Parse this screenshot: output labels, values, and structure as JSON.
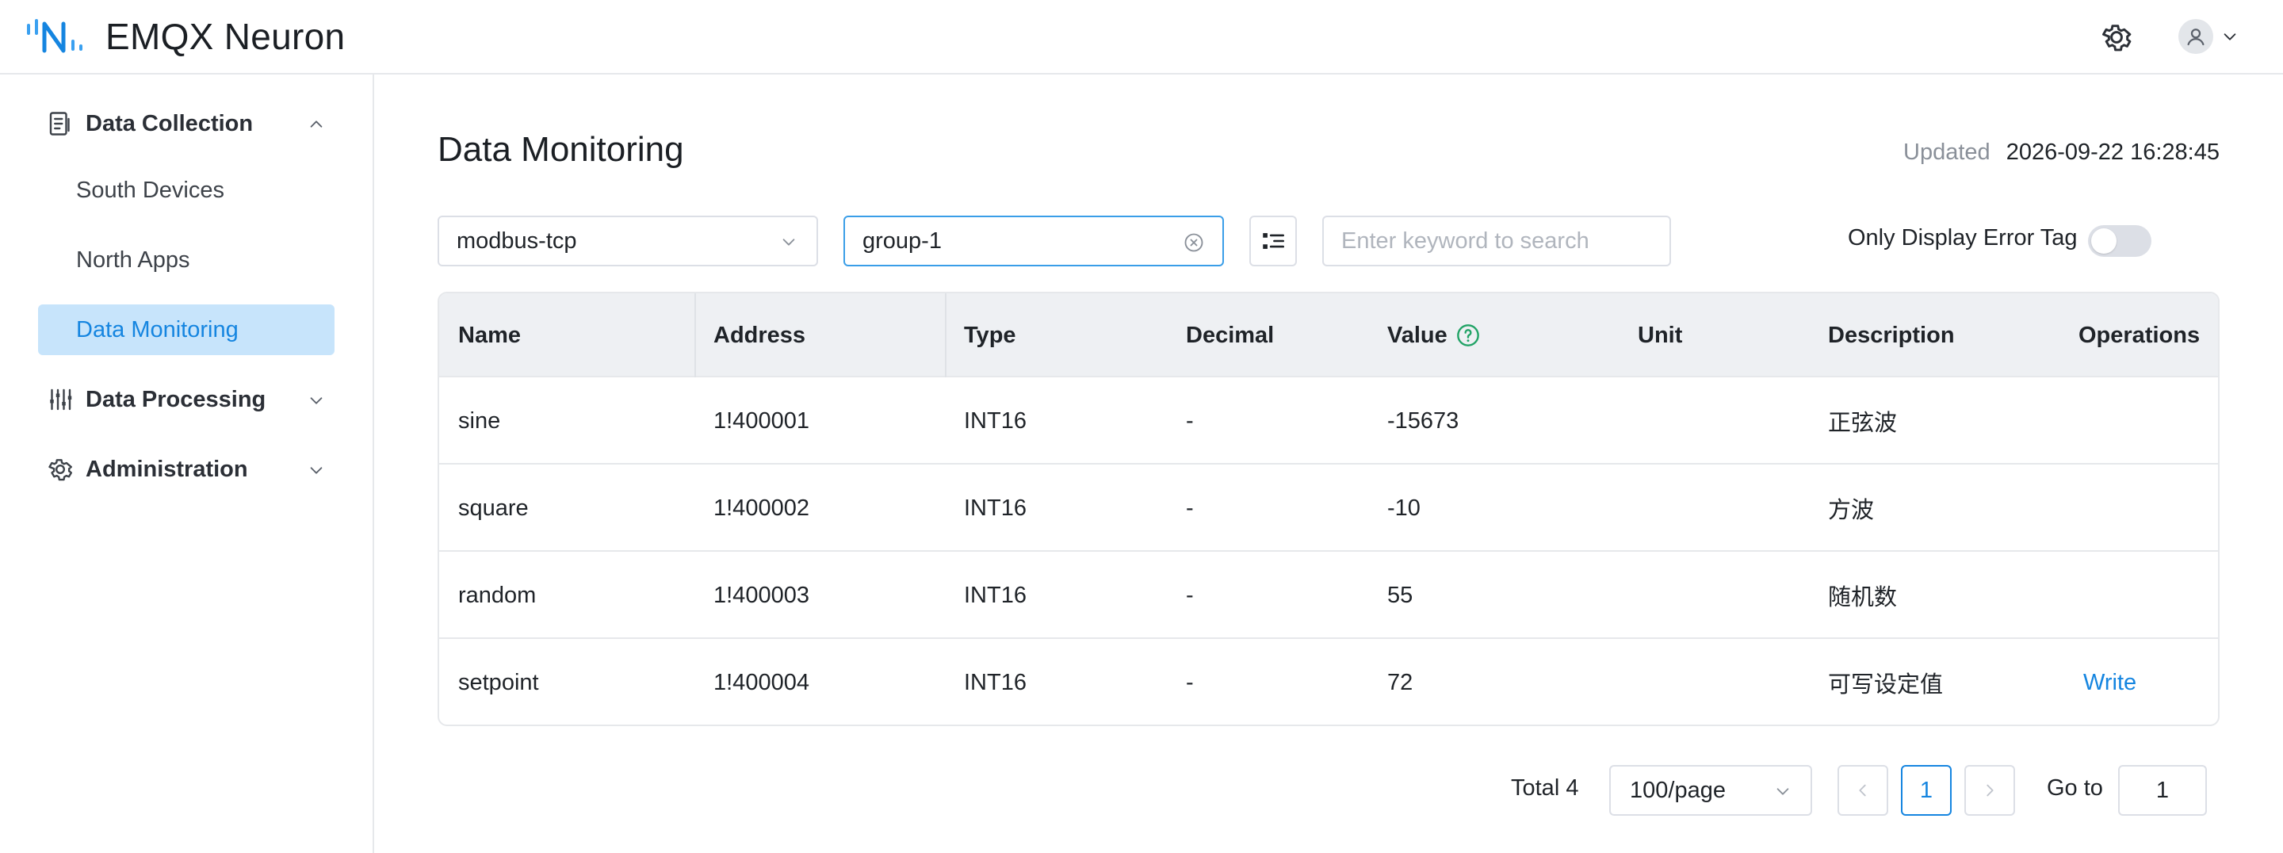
{
  "app": {
    "brand": "EMQX Neuron",
    "accent_color": "#1585e0"
  },
  "header": {
    "settings_icon": "gear-icon",
    "user_icon": "user-icon"
  },
  "sidebar": {
    "groups": [
      {
        "label": "Data Collection",
        "icon": "list-icon",
        "expanded": true
      },
      {
        "label": "Data Processing",
        "icon": "sliders-icon",
        "expanded": false
      },
      {
        "label": "Administration",
        "icon": "gear-icon",
        "expanded": false
      }
    ],
    "items": [
      {
        "label": "South Devices"
      },
      {
        "label": "North Apps"
      },
      {
        "label": "Data Monitoring",
        "active": true
      }
    ]
  },
  "main": {
    "title": "Data Monitoring",
    "updated_label": "Updated",
    "updated_value": "2026-09-22 16:28:45",
    "filters": {
      "node_select": "modbus-tcp",
      "group_select": "group-1",
      "search_placeholder": "Enter keyword to search",
      "error_toggle_label": "Only Display Error Tag",
      "error_toggle_on": false
    },
    "table": {
      "columns": [
        "Name",
        "Address",
        "Type",
        "Decimal",
        "Value",
        "Unit",
        "Description",
        "Operations"
      ],
      "rows": [
        {
          "name": "sine",
          "address": "1!400001",
          "type": "INT16",
          "decimal": "-",
          "value": "-15673",
          "unit": "",
          "description": "正弦波",
          "operation": ""
        },
        {
          "name": "square",
          "address": "1!400002",
          "type": "INT16",
          "decimal": "-",
          "value": "-10",
          "unit": "",
          "description": "方波",
          "operation": ""
        },
        {
          "name": "random",
          "address": "1!400003",
          "type": "INT16",
          "decimal": "-",
          "value": "55",
          "unit": "",
          "description": "随机数",
          "operation": ""
        },
        {
          "name": "setpoint",
          "address": "1!400004",
          "type": "INT16",
          "decimal": "-",
          "value": "72",
          "unit": "",
          "description": "可写设定值",
          "operation": "Write"
        }
      ]
    },
    "pagination": {
      "total": "Total 4",
      "page_size": "100/page",
      "current_page": "1",
      "goto_label": "Go to",
      "goto_value": "1"
    }
  }
}
